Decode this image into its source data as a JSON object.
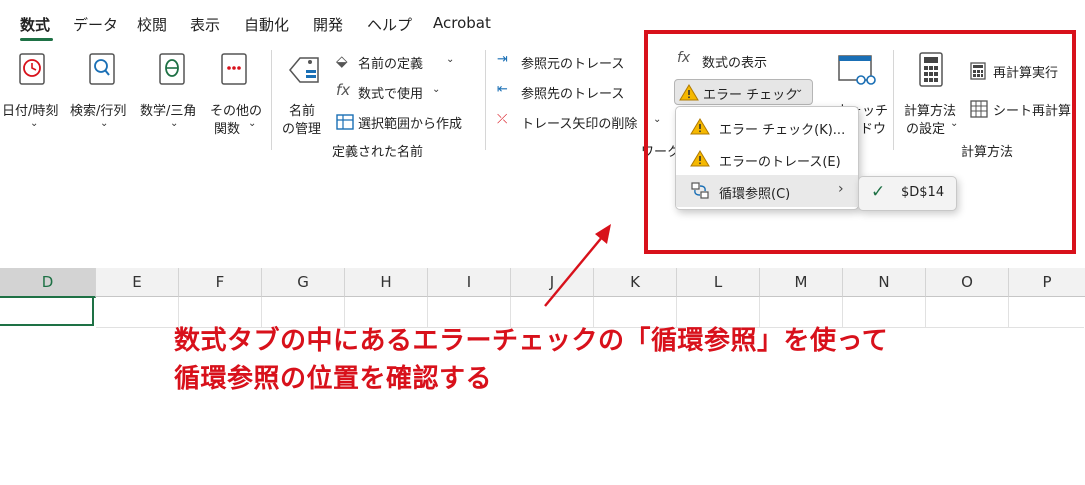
{
  "tabs": [
    {
      "label": "数式",
      "active": true
    },
    {
      "label": "データ"
    },
    {
      "label": "校閲"
    },
    {
      "label": "表示"
    },
    {
      "label": "自動化"
    },
    {
      "label": "開発"
    },
    {
      "label": "ヘルプ"
    },
    {
      "label": "Acrobat"
    }
  ],
  "ribbon": {
    "library": {
      "datetime": "日付/時刻",
      "lookup": "検索/行列",
      "math": "数学/三角",
      "other_line1": "その他の",
      "other_line2": "関数"
    },
    "names": {
      "manager_line1": "名前",
      "manager_line2": "の管理",
      "define": "名前の定義",
      "use_in_formula": "数式で使用",
      "create_from_selection": "選択範囲から作成",
      "group_label": "定義された名前"
    },
    "auditing": {
      "trace_precedents": "参照元のトレース",
      "trace_dependents": "参照先のトレース",
      "remove_arrows": "トレース矢印の削除",
      "show_formulas": "数式の表示",
      "error_check": "エラー チェック",
      "group_label_partial": "ワーク",
      "watch_line1": "ウォッチ",
      "watch_line2": "ドウ"
    },
    "calculation": {
      "options_line1": "計算方法",
      "options_line2": "の設定",
      "calc_now": "再計算実行",
      "calc_sheet": "シート再計算",
      "group_label": "計算方法"
    }
  },
  "dropdown": {
    "items": [
      {
        "label": "エラー チェック(K)..."
      },
      {
        "label": "エラーのトレース(E)"
      },
      {
        "label": "循環参照(C)"
      }
    ],
    "submenu_item": "$D$14"
  },
  "columns": [
    "D",
    "E",
    "F",
    "G",
    "H",
    "I",
    "J",
    "K",
    "L",
    "M",
    "N",
    "O",
    "P"
  ],
  "annotation": {
    "line1": "数式タブの中にあるエラーチェックの「循環参照」を使って",
    "line2": "循環参照の位置を確認する"
  },
  "colors": {
    "accent": "#1e7145",
    "annotation": "#d8111b"
  }
}
